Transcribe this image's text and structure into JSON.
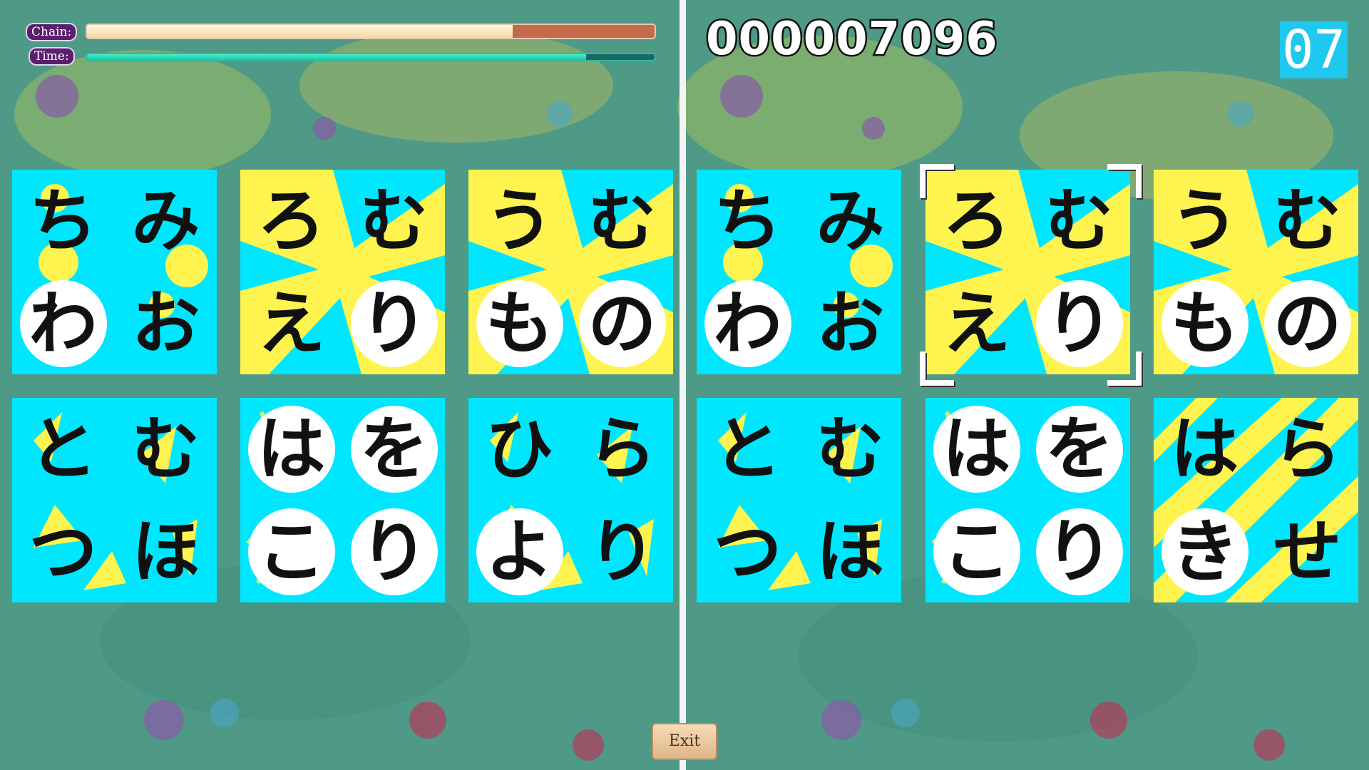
{
  "hud": {
    "chain_label": "Chain:",
    "time_label": "Time:",
    "chain_level": 0.75,
    "time_level": 0.88
  },
  "score": "000007096",
  "counter": "07",
  "exit_label": "Exit",
  "colors": {
    "tile_cyan": "#00e6ff",
    "tile_yellow": "#fff44f",
    "background": "#4f9a86"
  },
  "left_board": [
    {
      "style": "dots",
      "chars": [
        "ち",
        "み",
        "わ",
        "お"
      ],
      "circles": [
        false,
        false,
        true,
        false
      ]
    },
    {
      "style": "burst",
      "chars": [
        "ろ",
        "む",
        "え",
        "り"
      ],
      "circles": [
        false,
        false,
        false,
        true
      ]
    },
    {
      "style": "burst",
      "chars": [
        "う",
        "む",
        "も",
        "の"
      ],
      "circles": [
        false,
        false,
        true,
        true
      ]
    },
    {
      "style": "triangles",
      "chars": [
        "と",
        "む",
        "つ",
        "ほ"
      ],
      "circles": [
        false,
        false,
        false,
        false
      ]
    },
    {
      "style": "plain",
      "chars": [
        "は",
        "を",
        "こ",
        "り"
      ],
      "circles": [
        true,
        true,
        true,
        true
      ]
    },
    {
      "style": "triangles",
      "chars": [
        "ひ",
        "ら",
        "よ",
        "り"
      ],
      "circles": [
        false,
        false,
        true,
        false
      ]
    }
  ],
  "right_board": [
    {
      "style": "dots",
      "chars": [
        "ち",
        "み",
        "わ",
        "お"
      ],
      "circles": [
        false,
        false,
        true,
        false
      ]
    },
    {
      "style": "burst",
      "chars": [
        "ろ",
        "む",
        "え",
        "り"
      ],
      "circles": [
        false,
        false,
        false,
        true
      ],
      "selected": true
    },
    {
      "style": "burst",
      "chars": [
        "う",
        "む",
        "も",
        "の"
      ],
      "circles": [
        false,
        false,
        true,
        true
      ]
    },
    {
      "style": "triangles",
      "chars": [
        "と",
        "む",
        "つ",
        "ほ"
      ],
      "circles": [
        false,
        false,
        false,
        false
      ]
    },
    {
      "style": "plain",
      "chars": [
        "は",
        "を",
        "こ",
        "り"
      ],
      "circles": [
        true,
        true,
        true,
        true
      ]
    },
    {
      "style": "stripes",
      "chars": [
        "は",
        "ら",
        "き",
        "せ"
      ],
      "circles": [
        false,
        false,
        true,
        false
      ]
    }
  ]
}
